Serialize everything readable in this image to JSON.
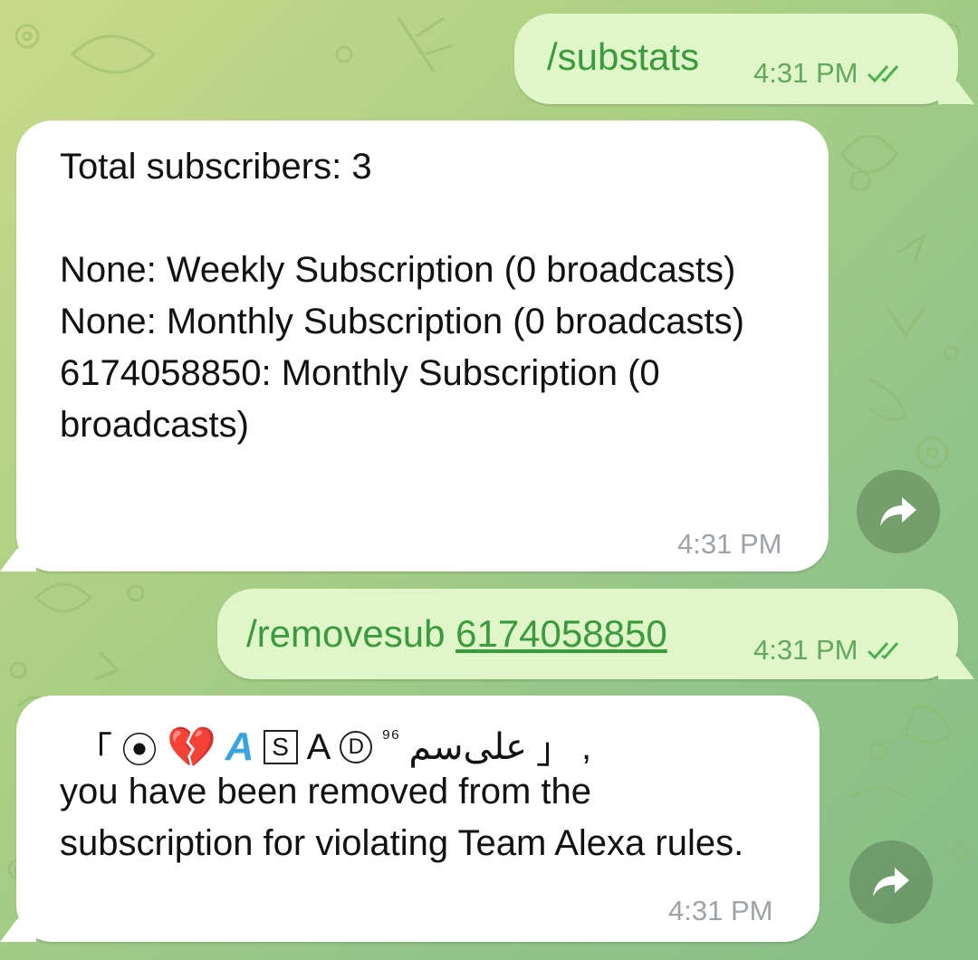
{
  "messages": [
    {
      "direction": "outgoing",
      "command": "/substats",
      "time": "4:31 PM",
      "status": "read"
    },
    {
      "direction": "incoming",
      "text": "Total subscribers: 3\n\nNone: Weekly Subscription (0 broadcasts)\nNone: Monthly Subscription (0 broadcasts)\n6174058850: Monthly Subscription (0 broadcasts)",
      "time": "4:31 PM",
      "forward_icon": "share-arrow-icon"
    },
    {
      "direction": "outgoing",
      "command": "/removesub",
      "command_arg": "6174058850",
      "time": "4:31 PM",
      "status": "read"
    },
    {
      "direction": "incoming",
      "username": {
        "open_bracket": "「",
        "target": "⦿",
        "heart": "💔",
        "letter_a": "A",
        "boxed_s": "S",
        "letter_a2": "A",
        "circled_d": "D",
        "superscript": "⁹⁶",
        "arabic": "علی‌سم",
        "close_bracket": "」",
        "comma": ","
      },
      "text": "you have been removed from the subscription for violating Team Alexa rules.",
      "time": "4:31 PM",
      "forward_icon": "share-arrow-icon"
    }
  ],
  "colors": {
    "outgoing_bubble": "#e0f6c8",
    "incoming_bubble": "#ffffff",
    "command_text": "#3a9a3e",
    "outgoing_meta": "#62a85f",
    "incoming_time": "#9ea3a7"
  }
}
